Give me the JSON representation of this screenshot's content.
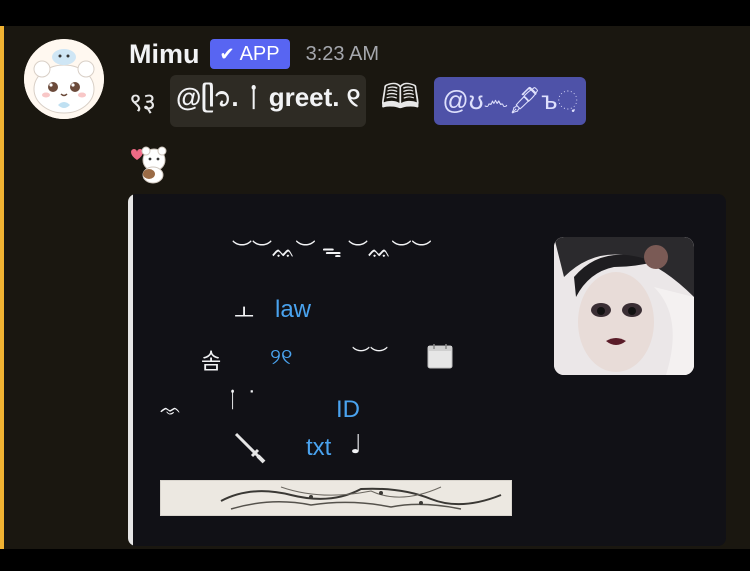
{
  "message": {
    "username": "Mimu",
    "badge": {
      "label": "APP",
      "icon": "check-icon"
    },
    "timestamp": "3:23 AM",
    "content": {
      "lead_glyph": "९३",
      "code_text": "@ᥫ᭡.  ᛙ      greet. ୧",
      "book_glyph": "🕮",
      "mention_text": "@ʊ෴🖋ъ઼",
      "sticker": "bear-with-heart"
    }
  },
  "embed": {
    "line1": "︶︶ᨐ︶ ᯓ ︶ᨐ︶︶",
    "line2_glyph": "ㅗ",
    "line2_link": "law",
    "line3_glyph": "솜",
    "line3_link": "୨୧",
    "line3_extra": "︶︶",
    "line4_glyph": "ᨎ",
    "line4_glyph2": "ᛙ  ˙",
    "line4_link": "ID",
    "line5_link": "txt",
    "line5_note": "♩",
    "accent_color": "#e6e6e6",
    "link_color": "#4aa3ef"
  },
  "colors": {
    "bot_badge": "#5865f2",
    "mention_bg": "#4e52a8",
    "highlight": "#f0b232"
  }
}
